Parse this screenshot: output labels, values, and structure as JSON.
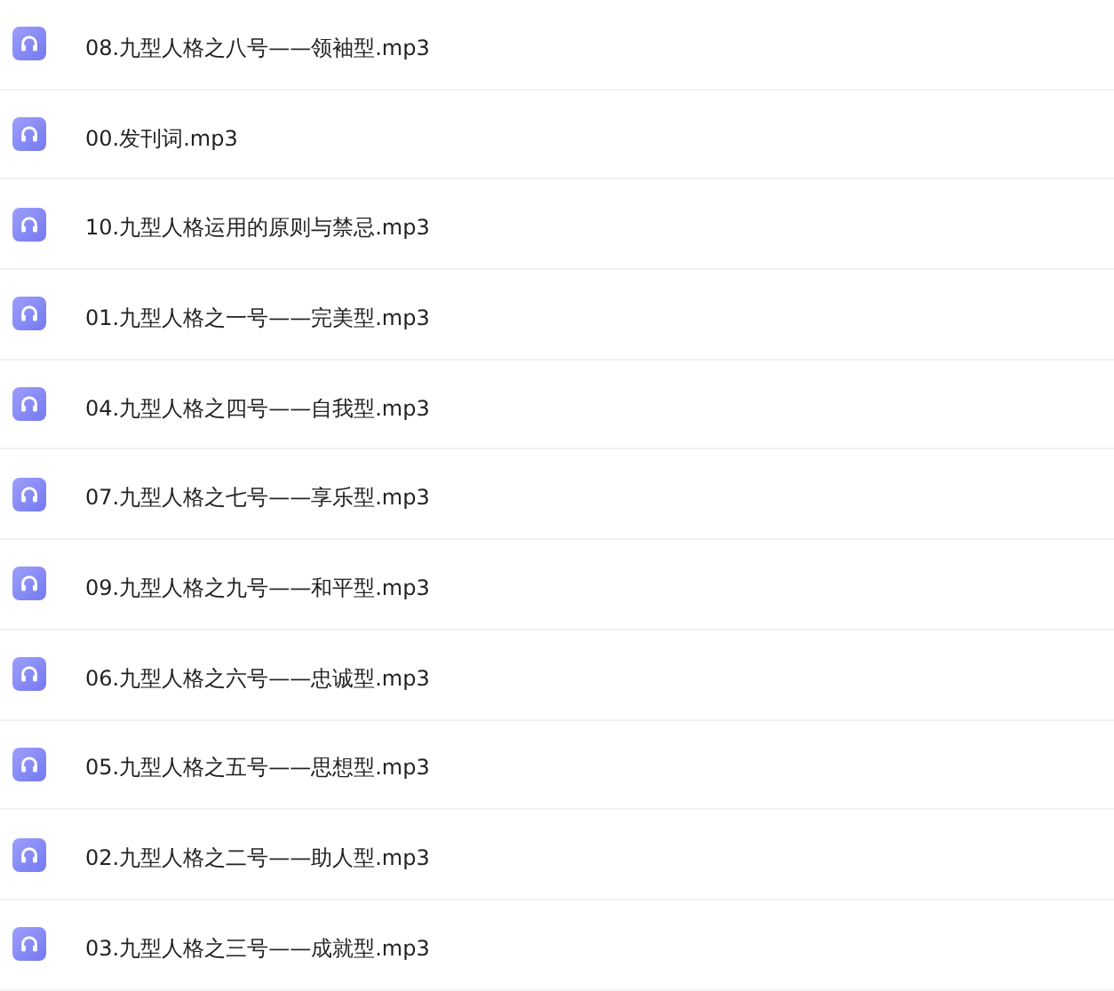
{
  "files": [
    {
      "name": "08.九型人格之八号——领袖型.mp3"
    },
    {
      "name": "00.发刊词.mp3"
    },
    {
      "name": "10.九型人格运用的原则与禁忌.mp3"
    },
    {
      "name": "01.九型人格之一号——完美型.mp3"
    },
    {
      "name": "04.九型人格之四号——自我型.mp3"
    },
    {
      "name": "07.九型人格之七号——享乐型.mp3"
    },
    {
      "name": "09.九型人格之九号——和平型.mp3"
    },
    {
      "name": "06.九型人格之六号——忠诚型.mp3"
    },
    {
      "name": "05.九型人格之五号——思想型.mp3"
    },
    {
      "name": "02.九型人格之二号——助人型.mp3"
    },
    {
      "name": "03.九型人格之三号——成就型.mp3"
    }
  ]
}
